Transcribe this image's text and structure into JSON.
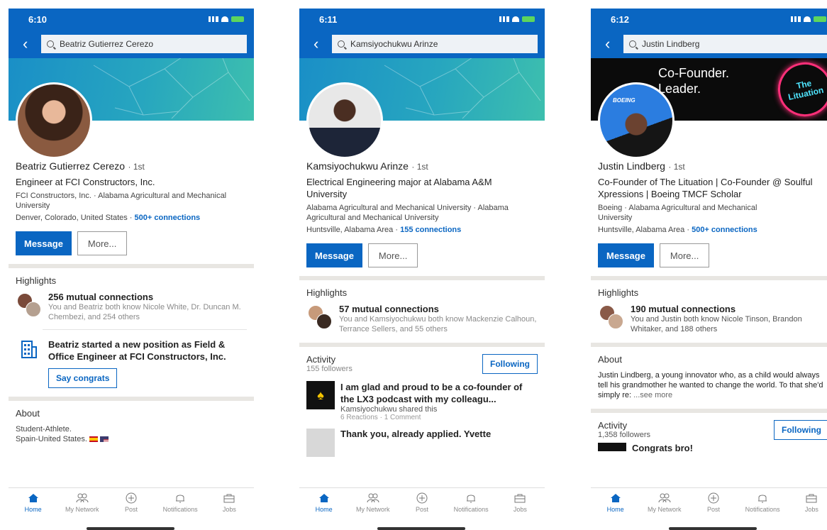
{
  "nav": [
    "Home",
    "My Network",
    "Post",
    "Notifications",
    "Jobs"
  ],
  "colors": {
    "accent": "#0a66c2",
    "header": "#0a66c2",
    "separator": "#e8e6e2"
  },
  "phones": [
    {
      "time": "6:10",
      "search": "Beatriz Gutierrez Cerezo",
      "name": "Beatriz Gutierrez Cerezo",
      "degree": "· 1st",
      "headline": "Engineer at FCI Constructors, Inc.",
      "org": "FCI Constructors, Inc. · Alabama Agricultural and Mechanical University",
      "location": "Denver, Colorado, United States ·",
      "connections": "500+ connections",
      "message": "Message",
      "more": "More...",
      "highlights": "Highlights",
      "mutual_title": "256 mutual connections",
      "mutual_sub": "You and Beatriz both know Nicole White, Dr. Duncan M. Chembezi, and 254 others",
      "position_text": "Beatriz started a new position as Field & Office Engineer at FCI Constructors, Inc.",
      "congrats": "Say congrats",
      "about_title": "About",
      "about_l1": "Student-Athlete.",
      "about_l2": "Spain-United States."
    },
    {
      "time": "6:11",
      "search": "Kamsiyochukwu Arinze",
      "name": "Kamsiyochukwu Arinze",
      "degree": "· 1st",
      "headline": "Electrical Engineering major at Alabama A&M University",
      "org": "Alabama Agricultural and Mechanical University · Alabama Agricultural and Mechanical University",
      "location": "Huntsville, Alabama Area ·",
      "connections": "155 connections",
      "message": "Message",
      "more": "More...",
      "highlights": "Highlights",
      "mutual_title": "57 mutual connections",
      "mutual_sub": "You and Kamsiyochukwu both know Mackenzie Calhoun, Terrance Sellers, and 55 others",
      "activity": "Activity",
      "followers": "155 followers",
      "following": "Following",
      "post1_title": "I am glad and proud to be a co-founder of the LX3 podcast with my colleagu...",
      "post1_by": "Kamsiyochukwu shared this",
      "post1_meta": "6 Reactions · 1 Comment",
      "post2_title": "Thank you, already applied. Yvette"
    },
    {
      "time": "6:12",
      "search": "Justin Lindberg",
      "banner_text": "Co-Founder.\nLeader.",
      "banner_logo": "The\nLituation",
      "badge_text": "BOEING",
      "name": "Justin Lindberg",
      "degree": "· 1st",
      "headline": "Co-Founder of The Lituation | Co-Founder @ Soulful Xpressions | Boeing TMCF Scholar",
      "org": "Boeing · Alabama Agricultural and Mechanical University",
      "location": "Huntsville, Alabama Area ·",
      "connections": "500+ connections",
      "message": "Message",
      "more": "More...",
      "highlights": "Highlights",
      "mutual_title": "190 mutual connections",
      "mutual_sub": "You and Justin both know Nicole Tinson, Brandon Whitaker, and 188 others",
      "about_title": "About",
      "about_text": "Justin Lindberg, a young innovator who, as a child would always tell his grandmother he wanted to change the world. To that she'd simply re:",
      "see_more": "...see more",
      "activity": "Activity",
      "followers": "1,358 followers",
      "following": "Following",
      "post1_title": "Congrats bro!"
    }
  ]
}
